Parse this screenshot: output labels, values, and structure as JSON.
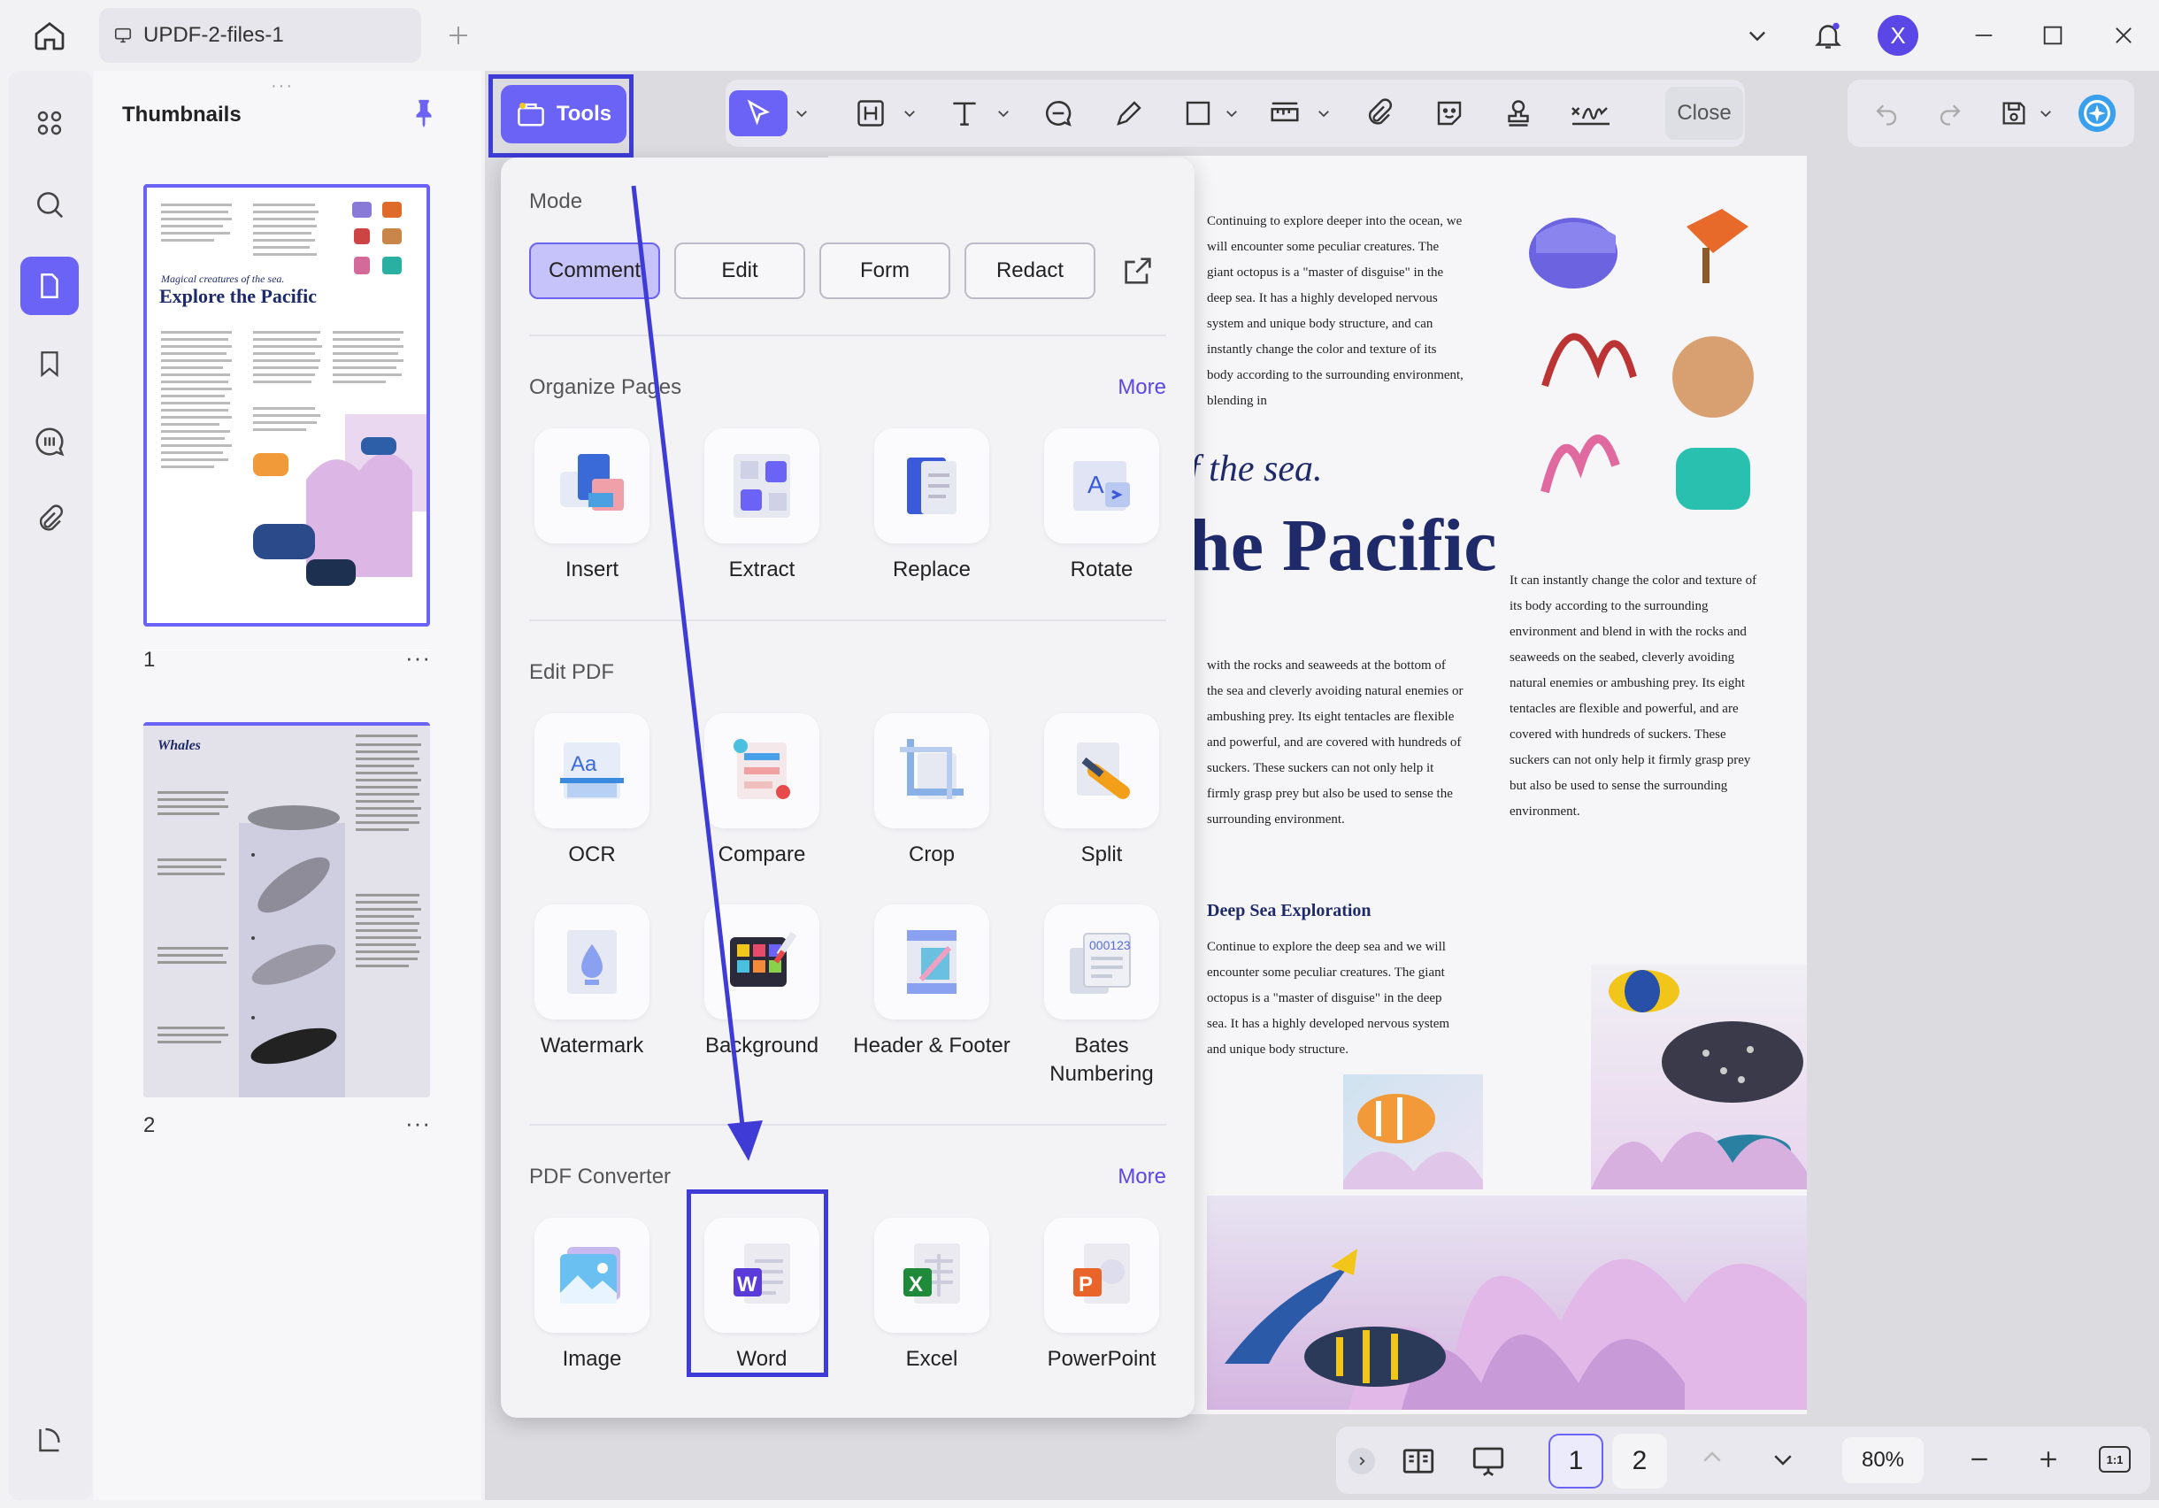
{
  "titlebar": {
    "file_name": "UPDF-2-files-1",
    "avatar_letter": "X"
  },
  "thumbnails": {
    "title": "Thumbnails",
    "pages": [
      {
        "number": "1",
        "more": "···"
      },
      {
        "number": "2",
        "more": "···"
      }
    ]
  },
  "toolbar": {
    "tools_label": "Tools",
    "close_label": "Close"
  },
  "dropdown": {
    "mode": {
      "title": "Mode",
      "buttons": [
        "Comment",
        "Edit",
        "Form",
        "Redact"
      ]
    },
    "organize": {
      "title": "Organize Pages",
      "more": "More",
      "items": [
        "Insert",
        "Extract",
        "Replace",
        "Rotate"
      ]
    },
    "edit_pdf": {
      "title": "Edit PDF",
      "items": [
        "OCR",
        "Compare",
        "Crop",
        "Split",
        "Watermark",
        "Background",
        "Header & Footer",
        "Bates Numbering"
      ]
    },
    "converter": {
      "title": "PDF Converter",
      "more": "More",
      "items": [
        "Image",
        "Word",
        "Excel",
        "PowerPoint"
      ]
    }
  },
  "page": {
    "col1_top": "Continuing to explore deeper into the ocean, we will encounter some peculiar creatures. The giant octopus is a \"master of disguise\" in the deep sea. It has a highly developed nervous system and unique body structure, and can instantly change the color and texture of its body according to the surrounding environment, blending in",
    "subtitle": "f the sea.",
    "heading": "he Pacific",
    "col1_mid": "with the rocks and seaweeds at the bottom of the sea and cleverly avoiding natural enemies or ambushing prey. Its eight tentacles are flexible and powerful, and are covered with hundreds of suckers. These suckers can not only help it firmly grasp prey but also be used to sense the surrounding environment.",
    "col2": "It can instantly change the color and texture of its body according to the surrounding environment and blend in with the rocks and seaweeds on the seabed, cleverly avoiding natural enemies or ambushing prey. Its eight tentacles are flexible and powerful, and are covered with hundreds of suckers. These suckers can not only help it firmly grasp prey but also be used to sense the surrounding environment.",
    "section_title": "Deep Sea Exploration",
    "section_text": "Continue to explore the deep sea and we will encounter some peculiar creatures. The giant octopus is a \"master of disguise\" in the deep sea. It has a highly developed nervous system and unique body structure."
  },
  "thumb1": {
    "subtitle": "Magical creatures of the sea.",
    "title": "Explore the Pacific"
  },
  "thumb2": {
    "title": "Whales"
  },
  "bottom": {
    "page1": "1",
    "page2": "2",
    "zoom": "80%",
    "fit": "1:1"
  },
  "colors": {
    "accent": "#6a63f5",
    "highlight": "#3e3bd6",
    "heading_navy": "#1f2a6b",
    "more_link": "#5b47e6"
  }
}
